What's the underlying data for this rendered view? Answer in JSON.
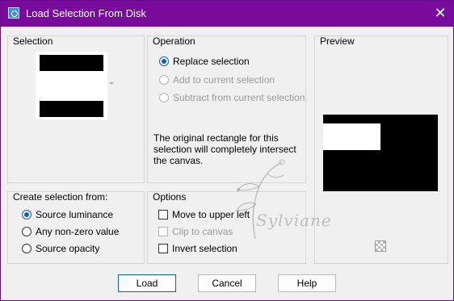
{
  "window": {
    "title": "Load Selection From Disk",
    "close_glyph": "✕"
  },
  "selection_group": {
    "title": "Selection"
  },
  "operation_group": {
    "title": "Operation",
    "options": [
      {
        "label": "Replace selection",
        "checked": true,
        "enabled": true
      },
      {
        "label": "Add to current selection",
        "checked": false,
        "enabled": false
      },
      {
        "label": "Subtract from current selection",
        "checked": false,
        "enabled": false
      }
    ],
    "info": "The original rectangle for this selection will completely intersect the canvas."
  },
  "preview_group": {
    "title": "Preview"
  },
  "create_from_group": {
    "title": "Create selection from:",
    "options": [
      {
        "label": "Source luminance",
        "checked": true
      },
      {
        "label": "Any non-zero value",
        "checked": false
      },
      {
        "label": "Source opacity",
        "checked": false
      }
    ]
  },
  "options_group": {
    "title": "Options",
    "checks": [
      {
        "label": "Move to upper left",
        "checked": false,
        "enabled": true
      },
      {
        "label": "Clip to canvas",
        "checked": false,
        "enabled": false
      },
      {
        "label": "Invert selection",
        "checked": false,
        "enabled": true
      }
    ]
  },
  "buttons": {
    "load": "Load",
    "cancel": "Cancel",
    "help": "Help"
  },
  "watermark": {
    "text": "Sylviane"
  },
  "colors": {
    "titlebar": "#780a9c",
    "accent": "#0a5fc0"
  }
}
